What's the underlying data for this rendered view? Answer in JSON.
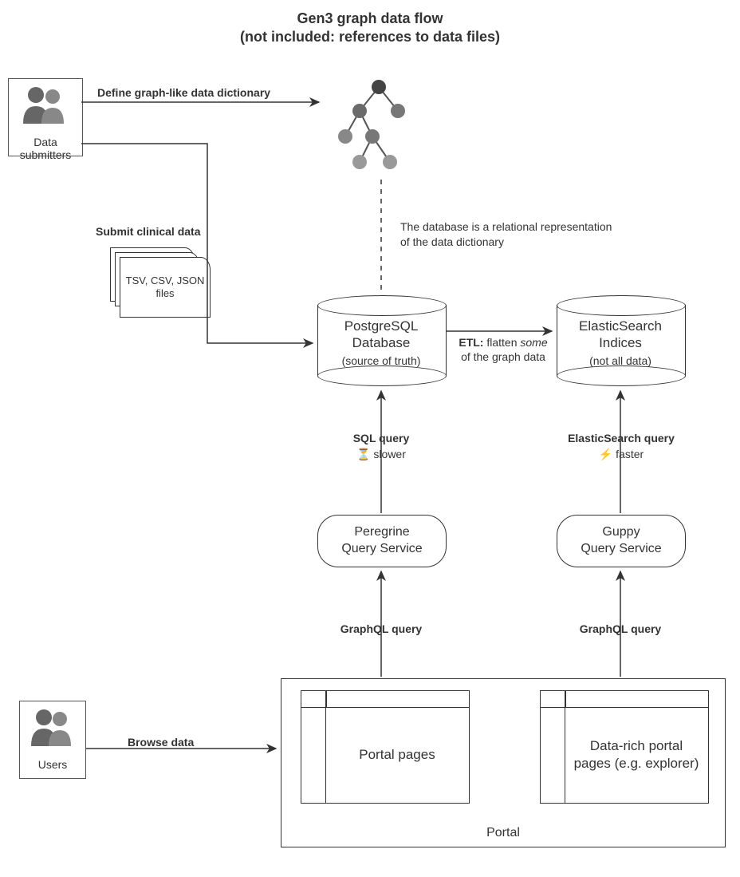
{
  "title": {
    "line1": "Gen3 graph data flow",
    "line2": "(not included: references to data files)"
  },
  "actors": {
    "data_submitters": "Data submitters",
    "users": "Users"
  },
  "labels": {
    "define_dd": "Define graph-like data dictionary",
    "submit_clinical": "Submit clinical data",
    "files": "TSV, CSV, JSON files",
    "browse_data": "Browse data",
    "db_note": "The database is a relational representation of the data dictionary",
    "etl_line1_prefix": "ETL:",
    "etl_line1_rest": " flatten ",
    "etl_line1_italic": "some",
    "etl_line2": "of the graph data",
    "sql_query": "SQL query",
    "sql_speed_icon": "⏳",
    "sql_speed": " slower",
    "es_query": "ElasticSearch query",
    "es_speed_icon": "⚡",
    "es_speed": " faster",
    "graphql_left": "GraphQL query",
    "graphql_right": "GraphQL query"
  },
  "db": {
    "postgres_l1": "PostgreSQL",
    "postgres_l2": "Database",
    "postgres_l3": "(source of truth)",
    "es_l1": "ElasticSearch",
    "es_l2": "Indices",
    "es_l3": "(not all data)"
  },
  "services": {
    "peregrine_l1": "Peregrine",
    "peregrine_l2": "Query Service",
    "guppy_l1": "Guppy",
    "guppy_l2": "Query Service"
  },
  "portal": {
    "caption": "Portal",
    "pages": "Portal pages",
    "explorer": "Data-rich portal pages (e.g. explorer)"
  }
}
